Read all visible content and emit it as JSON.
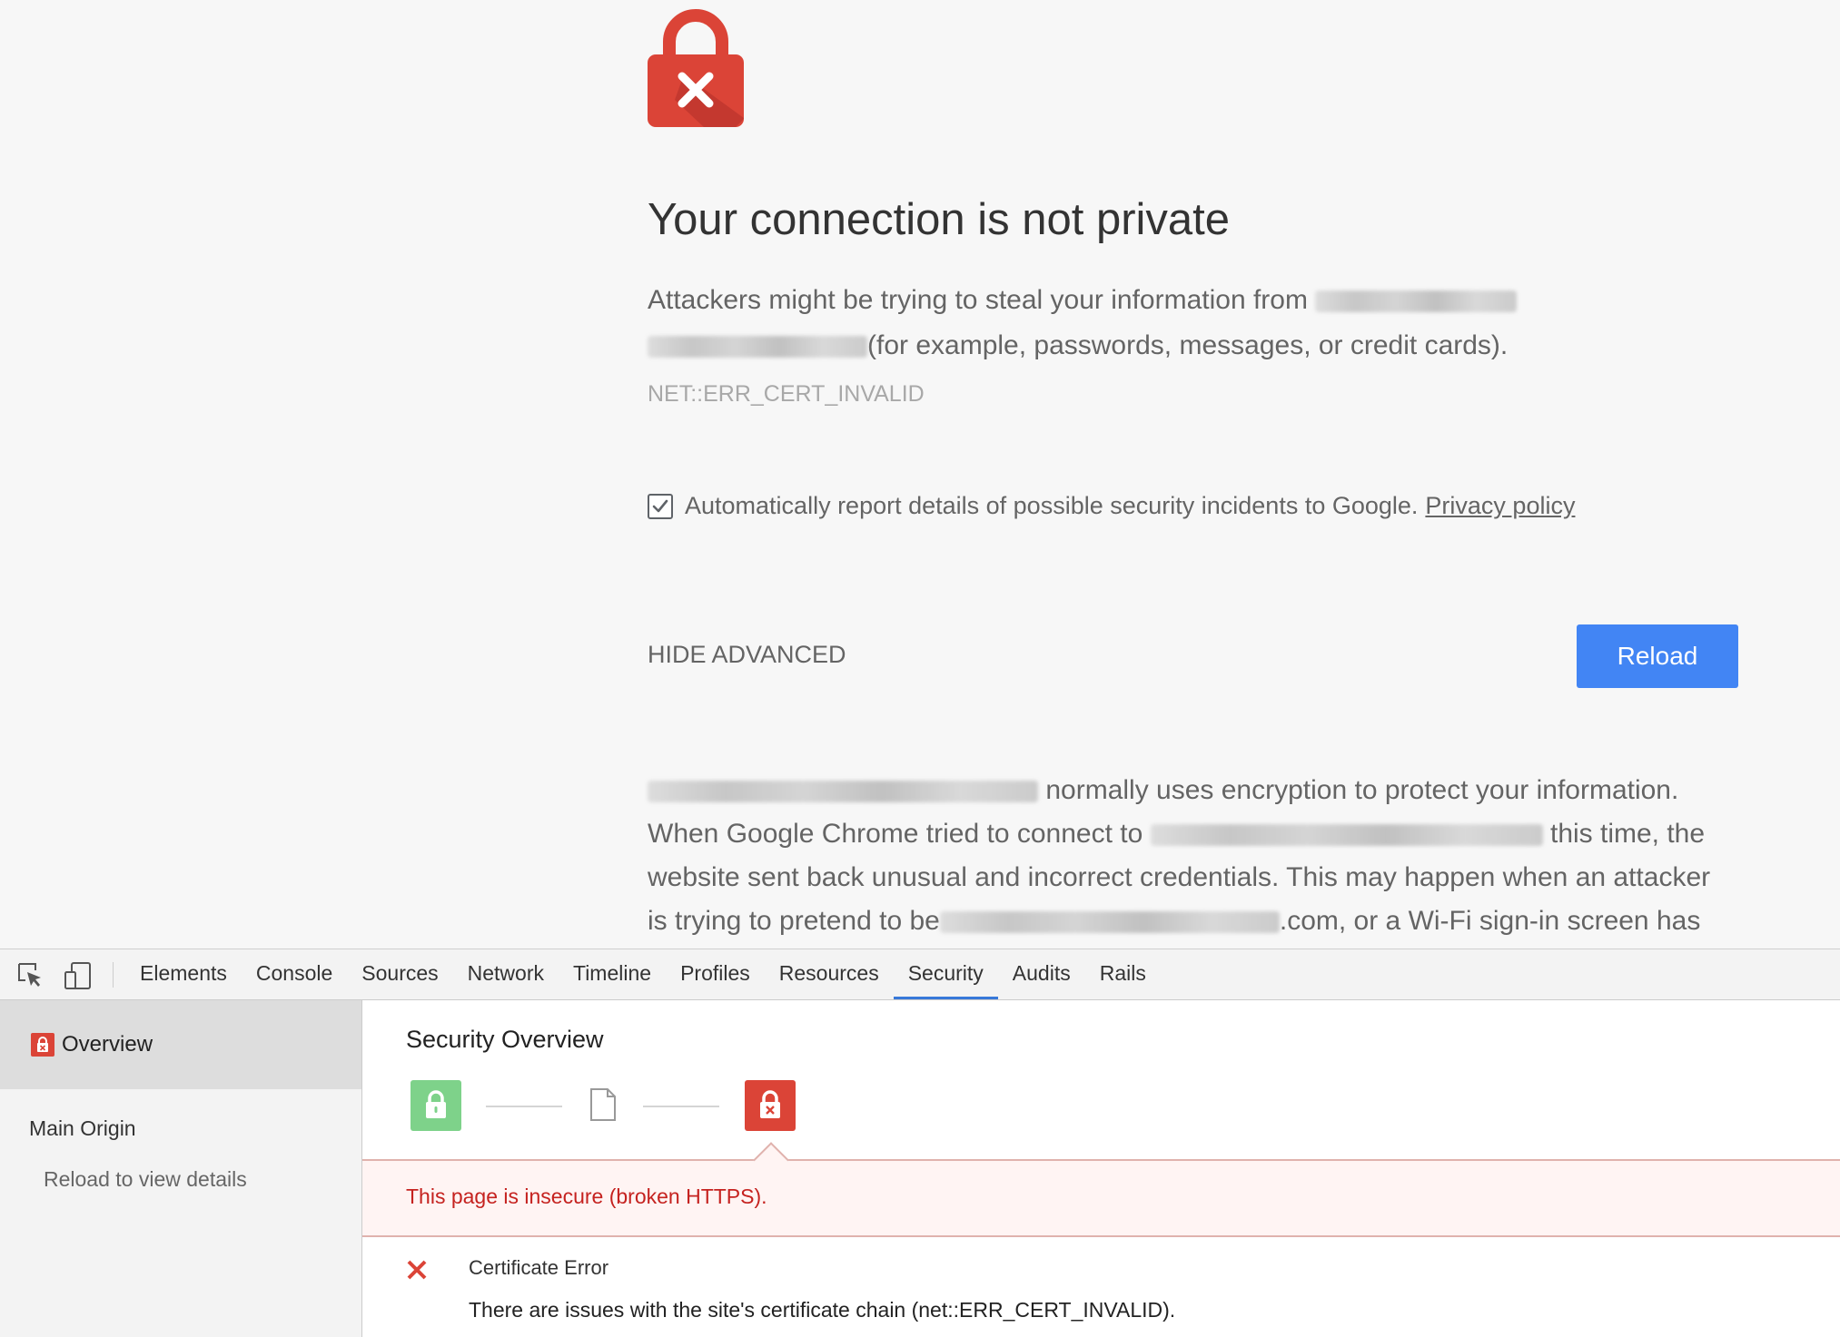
{
  "interstitial": {
    "title": "Your connection is not private",
    "para_1_a": "Attackers might be trying to steal your information from",
    "para_1_b": "(for example, passwords, messages, or credit cards).",
    "error_code": "NET::ERR_CERT_INVALID",
    "report_text": "Automatically report details of possible security incidents to Google.",
    "privacy_link": "Privacy policy",
    "report_checked": true,
    "hide_advanced": "HIDE ADVANCED",
    "reload_label": "Reload",
    "advanced_1": "normally uses encryption to protect your information.",
    "advanced_2a": "When Google Chrome tried to connect to",
    "advanced_2b": "this time, the",
    "advanced_3": "website sent back unusual and incorrect credentials. This may happen when an attacker",
    "advanced_4a": "is trying to pretend to be",
    "advanced_4b": ".com, or a Wi-Fi sign-in screen has"
  },
  "devtools": {
    "tabs": [
      "Elements",
      "Console",
      "Sources",
      "Network",
      "Timeline",
      "Profiles",
      "Resources",
      "Security",
      "Audits",
      "Rails"
    ],
    "active_tab": "Security",
    "sidebar": {
      "overview": "Overview",
      "main_origin": "Main Origin",
      "reload_details": "Reload to view details"
    },
    "main": {
      "title": "Security Overview",
      "insecure": "This page is insecure (broken HTTPS).",
      "cert_title": "Certificate Error",
      "cert_desc": "There are issues with the site's certificate chain (net::ERR_CERT_INVALID)."
    }
  },
  "colors": {
    "error_red": "#db4437",
    "reload_blue": "#4285f4",
    "secure_green": "#7ed28a",
    "insecure_text": "#c5221f"
  },
  "icons": [
    "lock-error-icon",
    "inspect-element-icon",
    "device-mode-icon",
    "lock-icon",
    "document-icon",
    "close-x-icon",
    "checkmark-icon"
  ]
}
